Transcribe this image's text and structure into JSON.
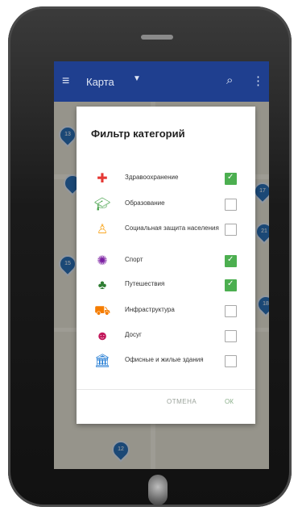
{
  "appbar": {
    "menu_icon": "menu-icon",
    "title": "Карта",
    "dropdown_icon": "caret-down-icon",
    "search_icon": "search-icon",
    "more_icon": "more-icon"
  },
  "dialog": {
    "title": "Фильтр категорий",
    "items": [
      {
        "label": "Здравоохранение",
        "checked": true,
        "icon": "health-cross-icon",
        "color": "#e53935"
      },
      {
        "label": "Образование",
        "checked": false,
        "icon": "education-cap-icon",
        "color": "#43a047"
      },
      {
        "label": "Социальная защита населения",
        "checked": false,
        "icon": "people-icon",
        "color": "#f9a825"
      },
      {
        "label": "Спорт",
        "checked": true,
        "icon": "sport-ball-icon",
        "color": "#7b1fa2"
      },
      {
        "label": "Путешествия",
        "checked": true,
        "icon": "palm-tree-icon",
        "color": "#2e7d32"
      },
      {
        "label": "Инфраструктура",
        "checked": false,
        "icon": "cart-icon",
        "color": "#f57c00"
      },
      {
        "label": "Досуг",
        "checked": false,
        "icon": "theater-masks-icon",
        "color": "#c2185b"
      },
      {
        "label": "Офисные и жилые здания",
        "checked": false,
        "icon": "building-icon",
        "color": "#1976d2"
      }
    ],
    "cancel_label": "ОТМЕНА",
    "ok_label": "ОК"
  },
  "map_pins": [
    "13",
    "17",
    "21",
    "15",
    "18",
    "12"
  ],
  "colors": {
    "appbar": "#1f3f8f",
    "pin": "#2a6fb6",
    "checked": "#4caf50"
  }
}
